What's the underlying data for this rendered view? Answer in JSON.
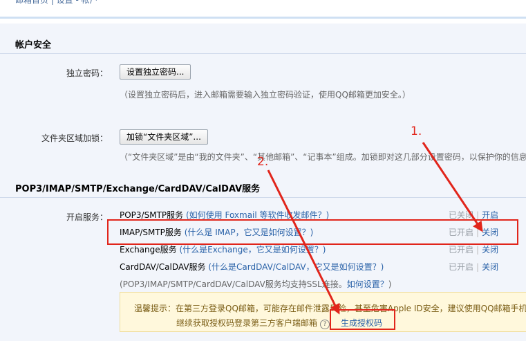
{
  "breadcrumb": "邮箱首页 | 设置 - 帐户",
  "security": {
    "title": "帐户安全",
    "password_label": "独立密码：",
    "password_button": "设置独立密码...",
    "password_hint": "（设置独立密码后，进入邮箱需要输入独立密码验证，使用QQ邮箱更加安全。）",
    "folder_label": "文件夹区域加锁：",
    "folder_button": "加锁“文件夹区域”...",
    "folder_hint": "（“文件夹区域”是由“我的文件夹”、“其他邮箱”、“记事本”组成。加锁即对这几部分设置密码，以保护你的信息。）"
  },
  "services": {
    "title": "POP3/IMAP/SMTP/Exchange/CardDAV/CalDAV服务",
    "enable_label": "开启服务：",
    "rows": [
      {
        "name": "POP3/SMTP服务",
        "help": "(如何使用 Foxmail 等软件收发邮件？)",
        "status": "已关闭",
        "action": "开启"
      },
      {
        "name": "IMAP/SMTP服务",
        "help": "(什么是 IMAP，它又是如何设置？)",
        "status": "已开启",
        "action": "关闭"
      },
      {
        "name": "Exchange服务",
        "help": "(什么是Exchange，它又是如何设置？)",
        "status": "已开启",
        "action": "关闭"
      },
      {
        "name": "CardDAV/CalDAV服务",
        "help": "(什么是CardDAV/CalDAV，它又是如何设置？)",
        "status": "已开启",
        "action": "关闭"
      }
    ],
    "ssl_note": "(POP3/IMAP/SMTP/CardDAV/CalDAV服务均支持SSL连接。",
    "ssl_link": "如何设置？",
    "ssl_close": ")",
    "tip_line1": "温馨提示：在第三方登录QQ邮箱，可能存在邮件泄露风险，甚至危害Apple ID安全，建议使用QQ邮箱手机",
    "tip_line2": "继续获取授权码登录第三方客户端邮箱",
    "tip_q": "?",
    "generate_code": "生成授权码"
  },
  "annotations": {
    "one": "1.",
    "two": "2."
  },
  "colors": {
    "accent": "#2a62a8",
    "highlight": "#e1251b",
    "tip_bg": "#fff8dc"
  }
}
